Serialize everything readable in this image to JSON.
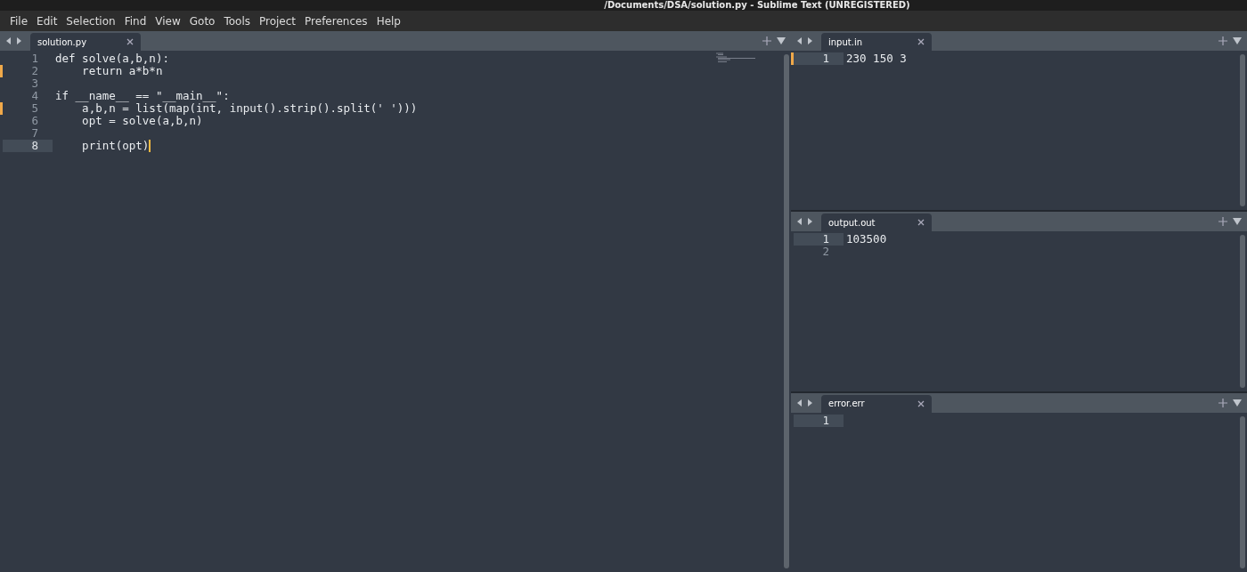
{
  "window": {
    "title": "/Documents/DSA/solution.py - Sublime Text (UNREGISTERED)"
  },
  "menu": [
    "File",
    "Edit",
    "Selection",
    "Find",
    "View",
    "Goto",
    "Tools",
    "Project",
    "Preferences",
    "Help"
  ],
  "panes": [
    {
      "tabs": [
        {
          "label": "solution.py",
          "selected": true
        }
      ],
      "minimap": true,
      "lines": [
        {
          "number": "1",
          "text": "def solve(a,b,n):",
          "modified": false,
          "current": false
        },
        {
          "number": "2",
          "text": "    return a*b*n",
          "modified": true,
          "current": false
        },
        {
          "number": "3",
          "modified": false,
          "current": false
        },
        {
          "number": "4",
          "text": "if __name__ == \"__main__\":",
          "modified": false,
          "current": false
        },
        {
          "number": "5",
          "text": "    a,b,n = list(map(int, input().strip().split(' ')))",
          "modified": true,
          "current": false
        },
        {
          "number": "6",
          "text": "    opt = solve(a,b,n)",
          "modified": false,
          "current": false
        },
        {
          "number": "7",
          "modified": false,
          "current": false
        },
        {
          "number": "8",
          "text": "    print(opt)",
          "modified": false,
          "current": true
        }
      ]
    },
    {
      "tabs": [
        {
          "label": "input.in",
          "selected": true
        }
      ],
      "lines": [
        {
          "number": "1",
          "text": "230 150 3",
          "modified": true,
          "current": true
        }
      ]
    },
    {
      "tabs": [
        {
          "label": "output.out",
          "selected": true
        }
      ],
      "lines": [
        {
          "number": "1",
          "text": "103500",
          "modified": false,
          "current": true
        },
        {
          "number": "2",
          "modified": false,
          "current": false
        }
      ]
    },
    {
      "tabs": [
        {
          "label": "error.err",
          "selected": true
        }
      ],
      "lines": [
        {
          "number": "1",
          "modified": false,
          "current": true
        }
      ]
    }
  ]
}
